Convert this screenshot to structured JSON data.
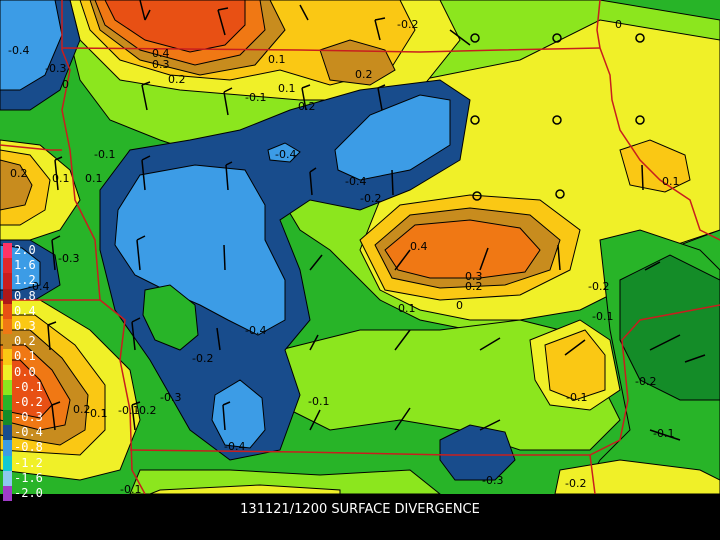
{
  "caption": "131121/1200 SURFACE DIVERGENCE",
  "legend": [
    {
      "label": "2.0",
      "color": "#ff3366"
    },
    {
      "label": "1.6",
      "color": "#e0282a"
    },
    {
      "label": "1.2",
      "color": "#c81e1e"
    },
    {
      "label": "0.8",
      "color": "#b01818"
    },
    {
      "label": "0.4",
      "color": "#e85014"
    },
    {
      "label": "0.3",
      "color": "#f07814"
    },
    {
      "label": "0.2",
      "color": "#c88c1e"
    },
    {
      "label": "0.1",
      "color": "#fac814"
    },
    {
      "label": "0.0",
      "color": "#f0f028"
    },
    {
      "label": "-0.1",
      "color": "#8ce61e"
    },
    {
      "label": "-0.2",
      "color": "#28b428"
    },
    {
      "label": "-0.3",
      "color": "#148c28"
    },
    {
      "label": "-0.4",
      "color": "#184c8c"
    },
    {
      "label": "-0.8",
      "color": "#3c9ce6"
    },
    {
      "label": "-1.2",
      "color": "#14c8d2"
    },
    {
      "label": "-1.6",
      "color": "#8cc8f0"
    },
    {
      "label": "-2.0",
      "color": "#a03cc8"
    }
  ],
  "contour_labels": [
    "-0.4",
    "-0.3",
    "0.4",
    "0.3",
    "0.2",
    "0.1",
    "-0.2",
    "0",
    "0.1",
    "0.2",
    "-0.1",
    "0",
    "-0.4",
    "-0.4",
    "-0.2",
    "-0.1",
    "0.1",
    "0.2",
    "0.4",
    "0.3",
    "0.2",
    "0.1",
    "0",
    "-0.2",
    "-0.1",
    "-0.3",
    "-0.4",
    "-0.2",
    "-0.3",
    "-0.4",
    "0.2",
    "0.1",
    "-0.1",
    "-0.2",
    "-0.1",
    "-0.1",
    "-0.1",
    "-0.3",
    "-0.2",
    "-0.1",
    "-0.2",
    "0.1",
    "0.2",
    "0.1",
    "-0.4"
  ],
  "colors": {
    "background": "#000000",
    "state_borders": "#c81e1e",
    "contour_lines": "#000000",
    "caption_text": "#ffffff"
  },
  "map_features": [
    "state-borders",
    "wind-barbs",
    "station-circles"
  ]
}
